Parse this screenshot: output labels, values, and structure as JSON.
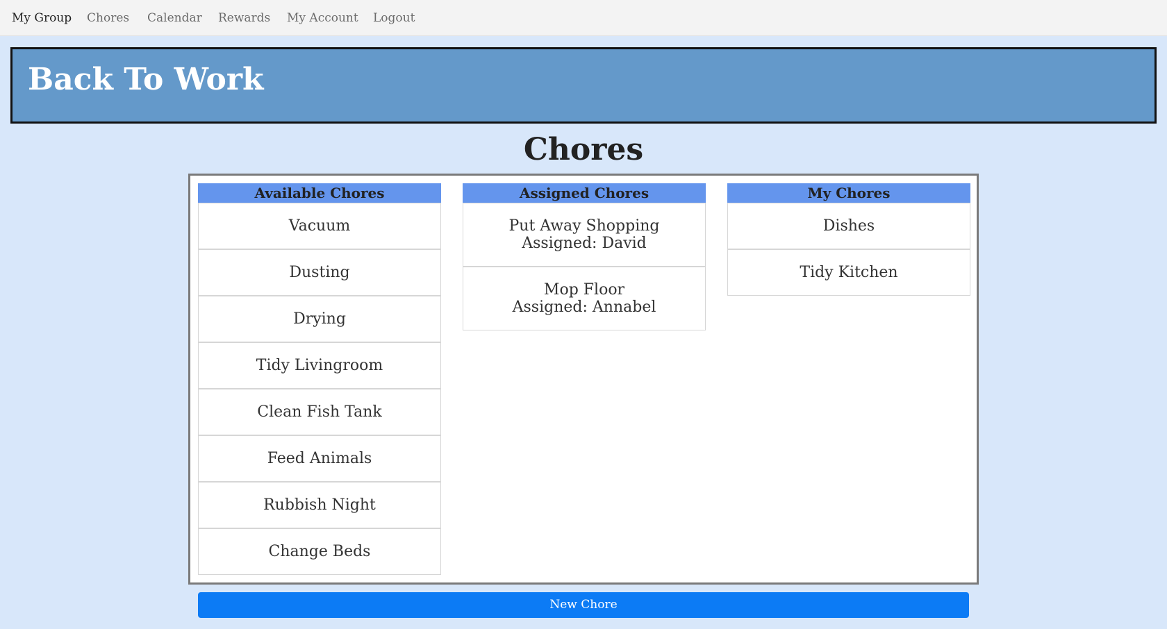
{
  "nav": {
    "items": [
      {
        "label": "My Group",
        "active": true
      },
      {
        "label": "Chores",
        "active": false
      },
      {
        "label": "Calendar",
        "active": false
      },
      {
        "label": "Rewards",
        "active": false
      },
      {
        "label": "My Account",
        "active": false
      },
      {
        "label": "Logout",
        "active": false
      }
    ]
  },
  "banner": {
    "title": "Back To Work"
  },
  "page": {
    "title": "Chores"
  },
  "columns": [
    {
      "header": "Available Chores",
      "chores": [
        {
          "name": "Vacuum"
        },
        {
          "name": "Dusting"
        },
        {
          "name": "Drying"
        },
        {
          "name": "Tidy Livingroom"
        },
        {
          "name": "Clean Fish Tank"
        },
        {
          "name": "Feed Animals"
        },
        {
          "name": "Rubbish Night"
        },
        {
          "name": "Change Beds"
        }
      ]
    },
    {
      "header": "Assigned Chores",
      "chores": [
        {
          "name": "Put Away Shopping",
          "assigned": "Assigned: David"
        },
        {
          "name": "Mop Floor",
          "assigned": "Assigned: Annabel"
        }
      ]
    },
    {
      "header": "My Chores",
      "chores": [
        {
          "name": "Dishes"
        },
        {
          "name": "Tidy Kitchen"
        }
      ]
    }
  ],
  "actions": {
    "new_chore_label": "New Chore"
  },
  "colors": {
    "background": "#d8e7fa",
    "banner": "#6499ca",
    "column_header": "#6495ed",
    "primary_button": "#0c7bf5"
  }
}
